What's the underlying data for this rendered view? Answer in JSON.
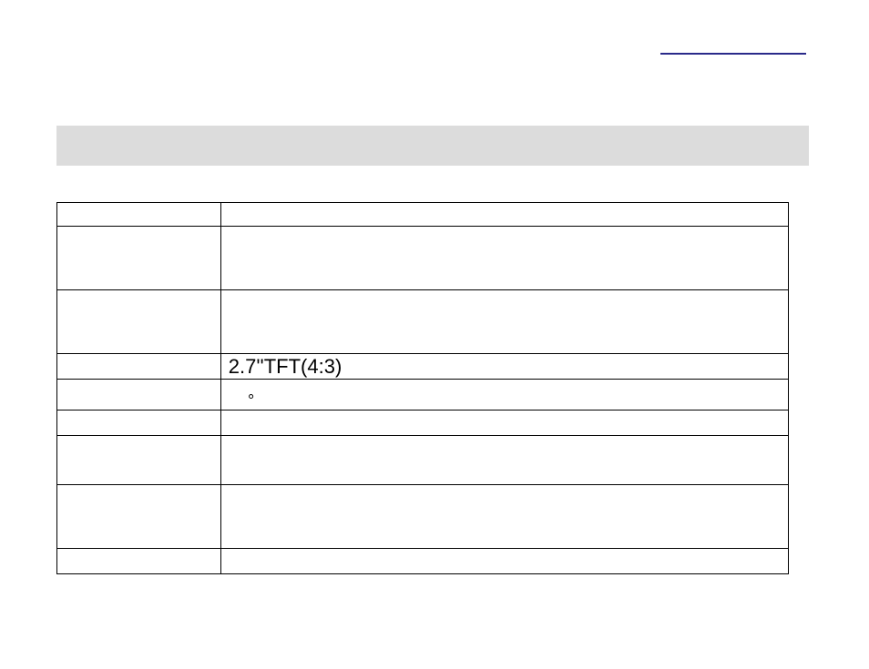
{
  "table": {
    "rows": [
      {
        "left": "",
        "right": ""
      },
      {
        "left": "",
        "right": ""
      },
      {
        "left": "",
        "right": ""
      },
      {
        "left": "",
        "right": "2.7''TFT(4:3)"
      },
      {
        "left": "",
        "right": ""
      },
      {
        "left": "",
        "right": ""
      },
      {
        "left": "",
        "right": ""
      },
      {
        "left": "",
        "right": ""
      },
      {
        "left": "",
        "right": ""
      }
    ]
  },
  "degree_symbol": "°"
}
